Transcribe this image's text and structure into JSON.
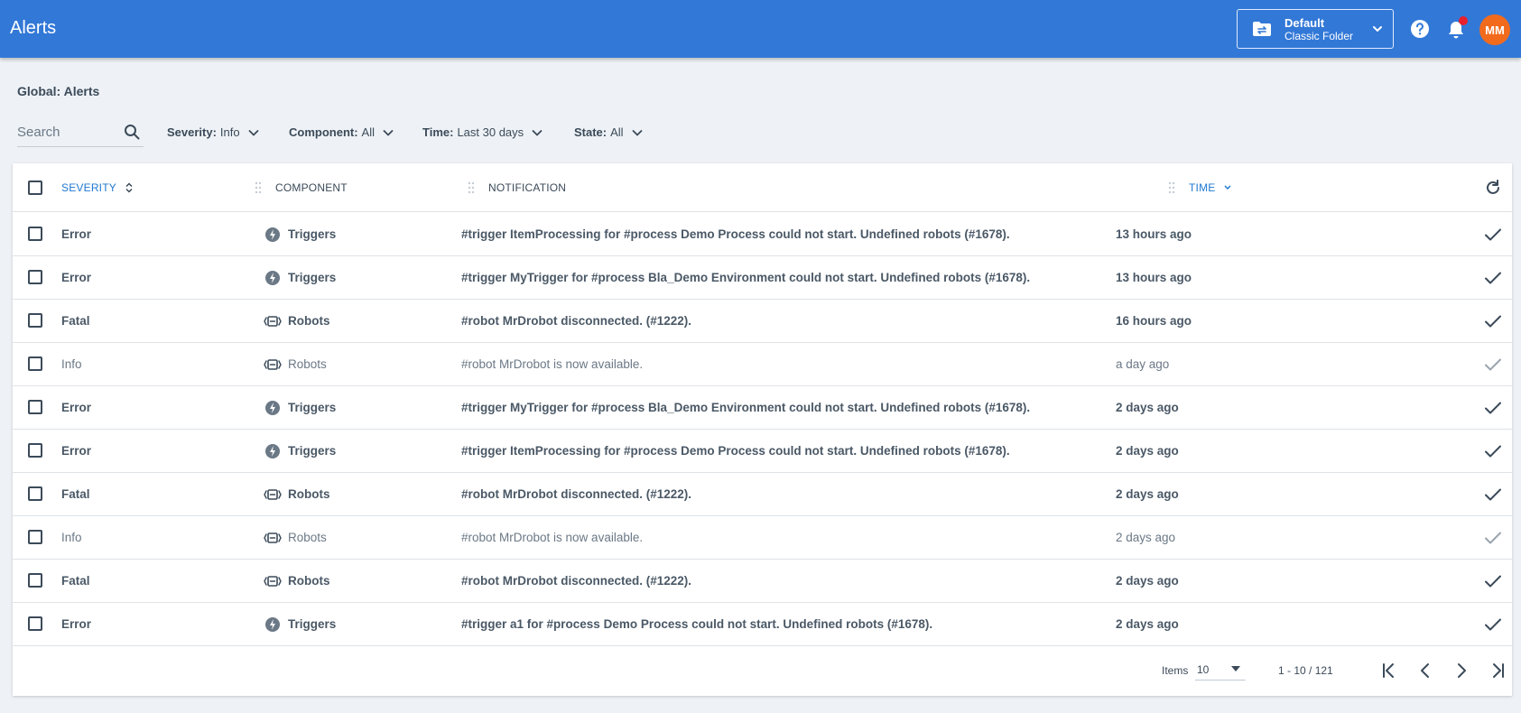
{
  "header": {
    "title": "Alerts",
    "folder": {
      "name": "Default",
      "sub": "Classic Folder"
    },
    "avatar_initials": "MM"
  },
  "breadcrumb": "Global: Alerts",
  "search": {
    "placeholder": "Search",
    "value": ""
  },
  "filters": [
    {
      "key": "Severity:",
      "value": "Info"
    },
    {
      "key": "Component:",
      "value": "All"
    },
    {
      "key": "Time:",
      "value": "Last 30 days"
    },
    {
      "key": "State:",
      "value": "All"
    }
  ],
  "table": {
    "columns": {
      "severity": "Severity",
      "component": "Component",
      "notification": "Notification",
      "time": "Time"
    },
    "rows": [
      {
        "severity": "Error",
        "component": "Triggers",
        "component_icon": "lightning-icon",
        "notification": "#trigger ItemProcessing for #process Demo Process could not start. Undefined robots (#1678).",
        "time": "13 hours ago",
        "read": false
      },
      {
        "severity": "Error",
        "component": "Triggers",
        "component_icon": "lightning-icon",
        "notification": "#trigger MyTrigger for #process Bla_Demo Environment could not start. Undefined robots (#1678).",
        "time": "13 hours ago",
        "read": false
      },
      {
        "severity": "Fatal",
        "component": "Robots",
        "component_icon": "robot-icon",
        "notification": "#robot MrDrobot disconnected. (#1222).",
        "time": "16 hours ago",
        "read": false
      },
      {
        "severity": "Info",
        "component": "Robots",
        "component_icon": "robot-icon",
        "notification": "#robot MrDrobot is now available.",
        "time": "a day ago",
        "read": true
      },
      {
        "severity": "Error",
        "component": "Triggers",
        "component_icon": "lightning-icon",
        "notification": "#trigger MyTrigger for #process Bla_Demo Environment could not start. Undefined robots (#1678).",
        "time": "2 days ago",
        "read": false
      },
      {
        "severity": "Error",
        "component": "Triggers",
        "component_icon": "lightning-icon",
        "notification": "#trigger ItemProcessing for #process Demo Process could not start. Undefined robots (#1678).",
        "time": "2 days ago",
        "read": false
      },
      {
        "severity": "Fatal",
        "component": "Robots",
        "component_icon": "robot-icon",
        "notification": "#robot MrDrobot disconnected. (#1222).",
        "time": "2 days ago",
        "read": false
      },
      {
        "severity": "Info",
        "component": "Robots",
        "component_icon": "robot-icon",
        "notification": "#robot MrDrobot is now available.",
        "time": "2 days ago",
        "read": true
      },
      {
        "severity": "Fatal",
        "component": "Robots",
        "component_icon": "robot-icon",
        "notification": "#robot MrDrobot disconnected. (#1222).",
        "time": "2 days ago",
        "read": false
      },
      {
        "severity": "Error",
        "component": "Triggers",
        "component_icon": "lightning-icon",
        "notification": "#trigger a1 for #process Demo Process could not start. Undefined robots (#1678).",
        "time": "2 days ago",
        "read": false
      }
    ]
  },
  "footer": {
    "items_label": "Items",
    "page_size": "10",
    "page_range": "1 - 10 / 121"
  },
  "colors": {
    "header_bg": "#3278d7",
    "accent": "#1f78d1",
    "avatar_bg": "#f26b1d",
    "notification_dot": "#e8202d"
  }
}
